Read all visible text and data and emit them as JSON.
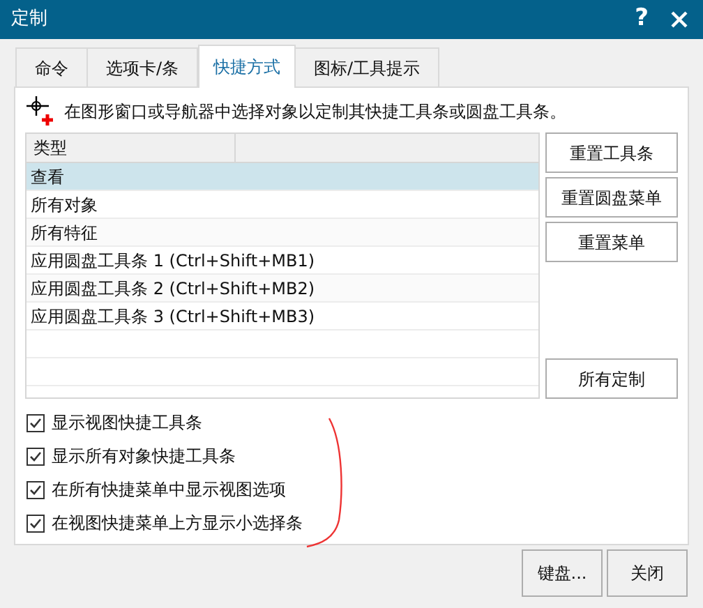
{
  "window": {
    "title": "定制",
    "help": "?"
  },
  "tabs": [
    {
      "label": "命令",
      "selected": false
    },
    {
      "label": "选项卡/条",
      "selected": false
    },
    {
      "label": "快捷方式",
      "selected": true
    },
    {
      "label": "图标/工具提示",
      "selected": false
    }
  ],
  "instruction": "在图形窗口或导航器中选择对象以定制其快捷工具条或圆盘工具条。",
  "table": {
    "columns": [
      "类型"
    ],
    "rows": [
      {
        "label": "查看",
        "selected": true
      },
      {
        "label": "所有对象",
        "selected": false
      },
      {
        "label": "所有特征",
        "selected": false
      },
      {
        "label": "应用圆盘工具条 1 (Ctrl+Shift+MB1)",
        "selected": false
      },
      {
        "label": "应用圆盘工具条 2 (Ctrl+Shift+MB2)",
        "selected": false
      },
      {
        "label": "应用圆盘工具条 3 (Ctrl+Shift+MB3)",
        "selected": false
      }
    ]
  },
  "side_buttons": [
    "重置工具条",
    "重置圆盘菜单",
    "重置菜单"
  ],
  "all_button": "所有定制",
  "options": [
    {
      "label": "显示视图快捷工具条",
      "checked": true
    },
    {
      "label": "显示所有对象快捷工具条",
      "checked": true
    },
    {
      "label": "在所有快捷菜单中显示视图选项",
      "checked": true
    },
    {
      "label": "在视图快捷菜单上方显示小选择条",
      "checked": true
    }
  ],
  "footer_buttons": [
    "键盘...",
    "关闭"
  ]
}
